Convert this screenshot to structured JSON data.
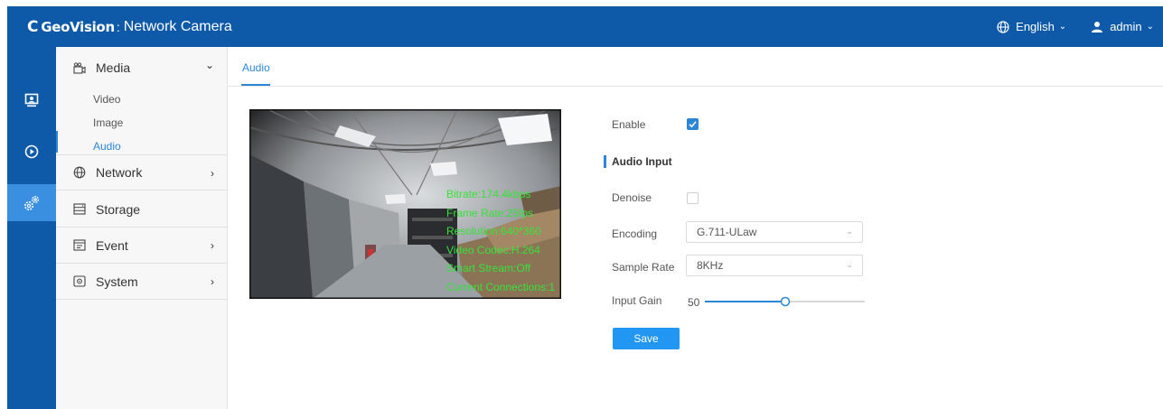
{
  "header": {
    "logo_text": "GeoVision",
    "separator": ":",
    "title": "Network Camera",
    "language": "English",
    "user": "admin"
  },
  "rail": [
    {
      "name": "live-view-icon"
    },
    {
      "name": "playback-icon"
    },
    {
      "name": "settings-icon",
      "active": true
    }
  ],
  "sidebar": {
    "media": {
      "label": "Media",
      "items": [
        "Video",
        "Image",
        "Audio"
      ],
      "active_item": "Audio"
    },
    "network": {
      "label": "Network"
    },
    "storage": {
      "label": "Storage"
    },
    "event": {
      "label": "Event"
    },
    "system": {
      "label": "System"
    }
  },
  "tab": {
    "label": "Audio"
  },
  "video": {
    "osd": [
      "Bitrate:174.4kbps",
      "Frame Rate:25fps",
      "Resolution:640*360",
      "Video Codec:H.264",
      "Smart Stream:Off",
      "Current Connections:1"
    ]
  },
  "form": {
    "enable_label": "Enable",
    "enable_checked": true,
    "section_title": "Audio Input",
    "denoise_label": "Denoise",
    "denoise_checked": false,
    "encoding_label": "Encoding",
    "encoding_value": "G.711-ULaw",
    "sample_rate_label": "Sample Rate",
    "sample_rate_value": "8KHz",
    "input_gain_label": "Input Gain",
    "input_gain_value": "50",
    "input_gain_fraction": 0.5,
    "save_label": "Save"
  },
  "colors": {
    "header": "#0f5aa8",
    "accent": "#2d86d8",
    "button": "#2196f3",
    "osd_text": "#38e23a"
  }
}
